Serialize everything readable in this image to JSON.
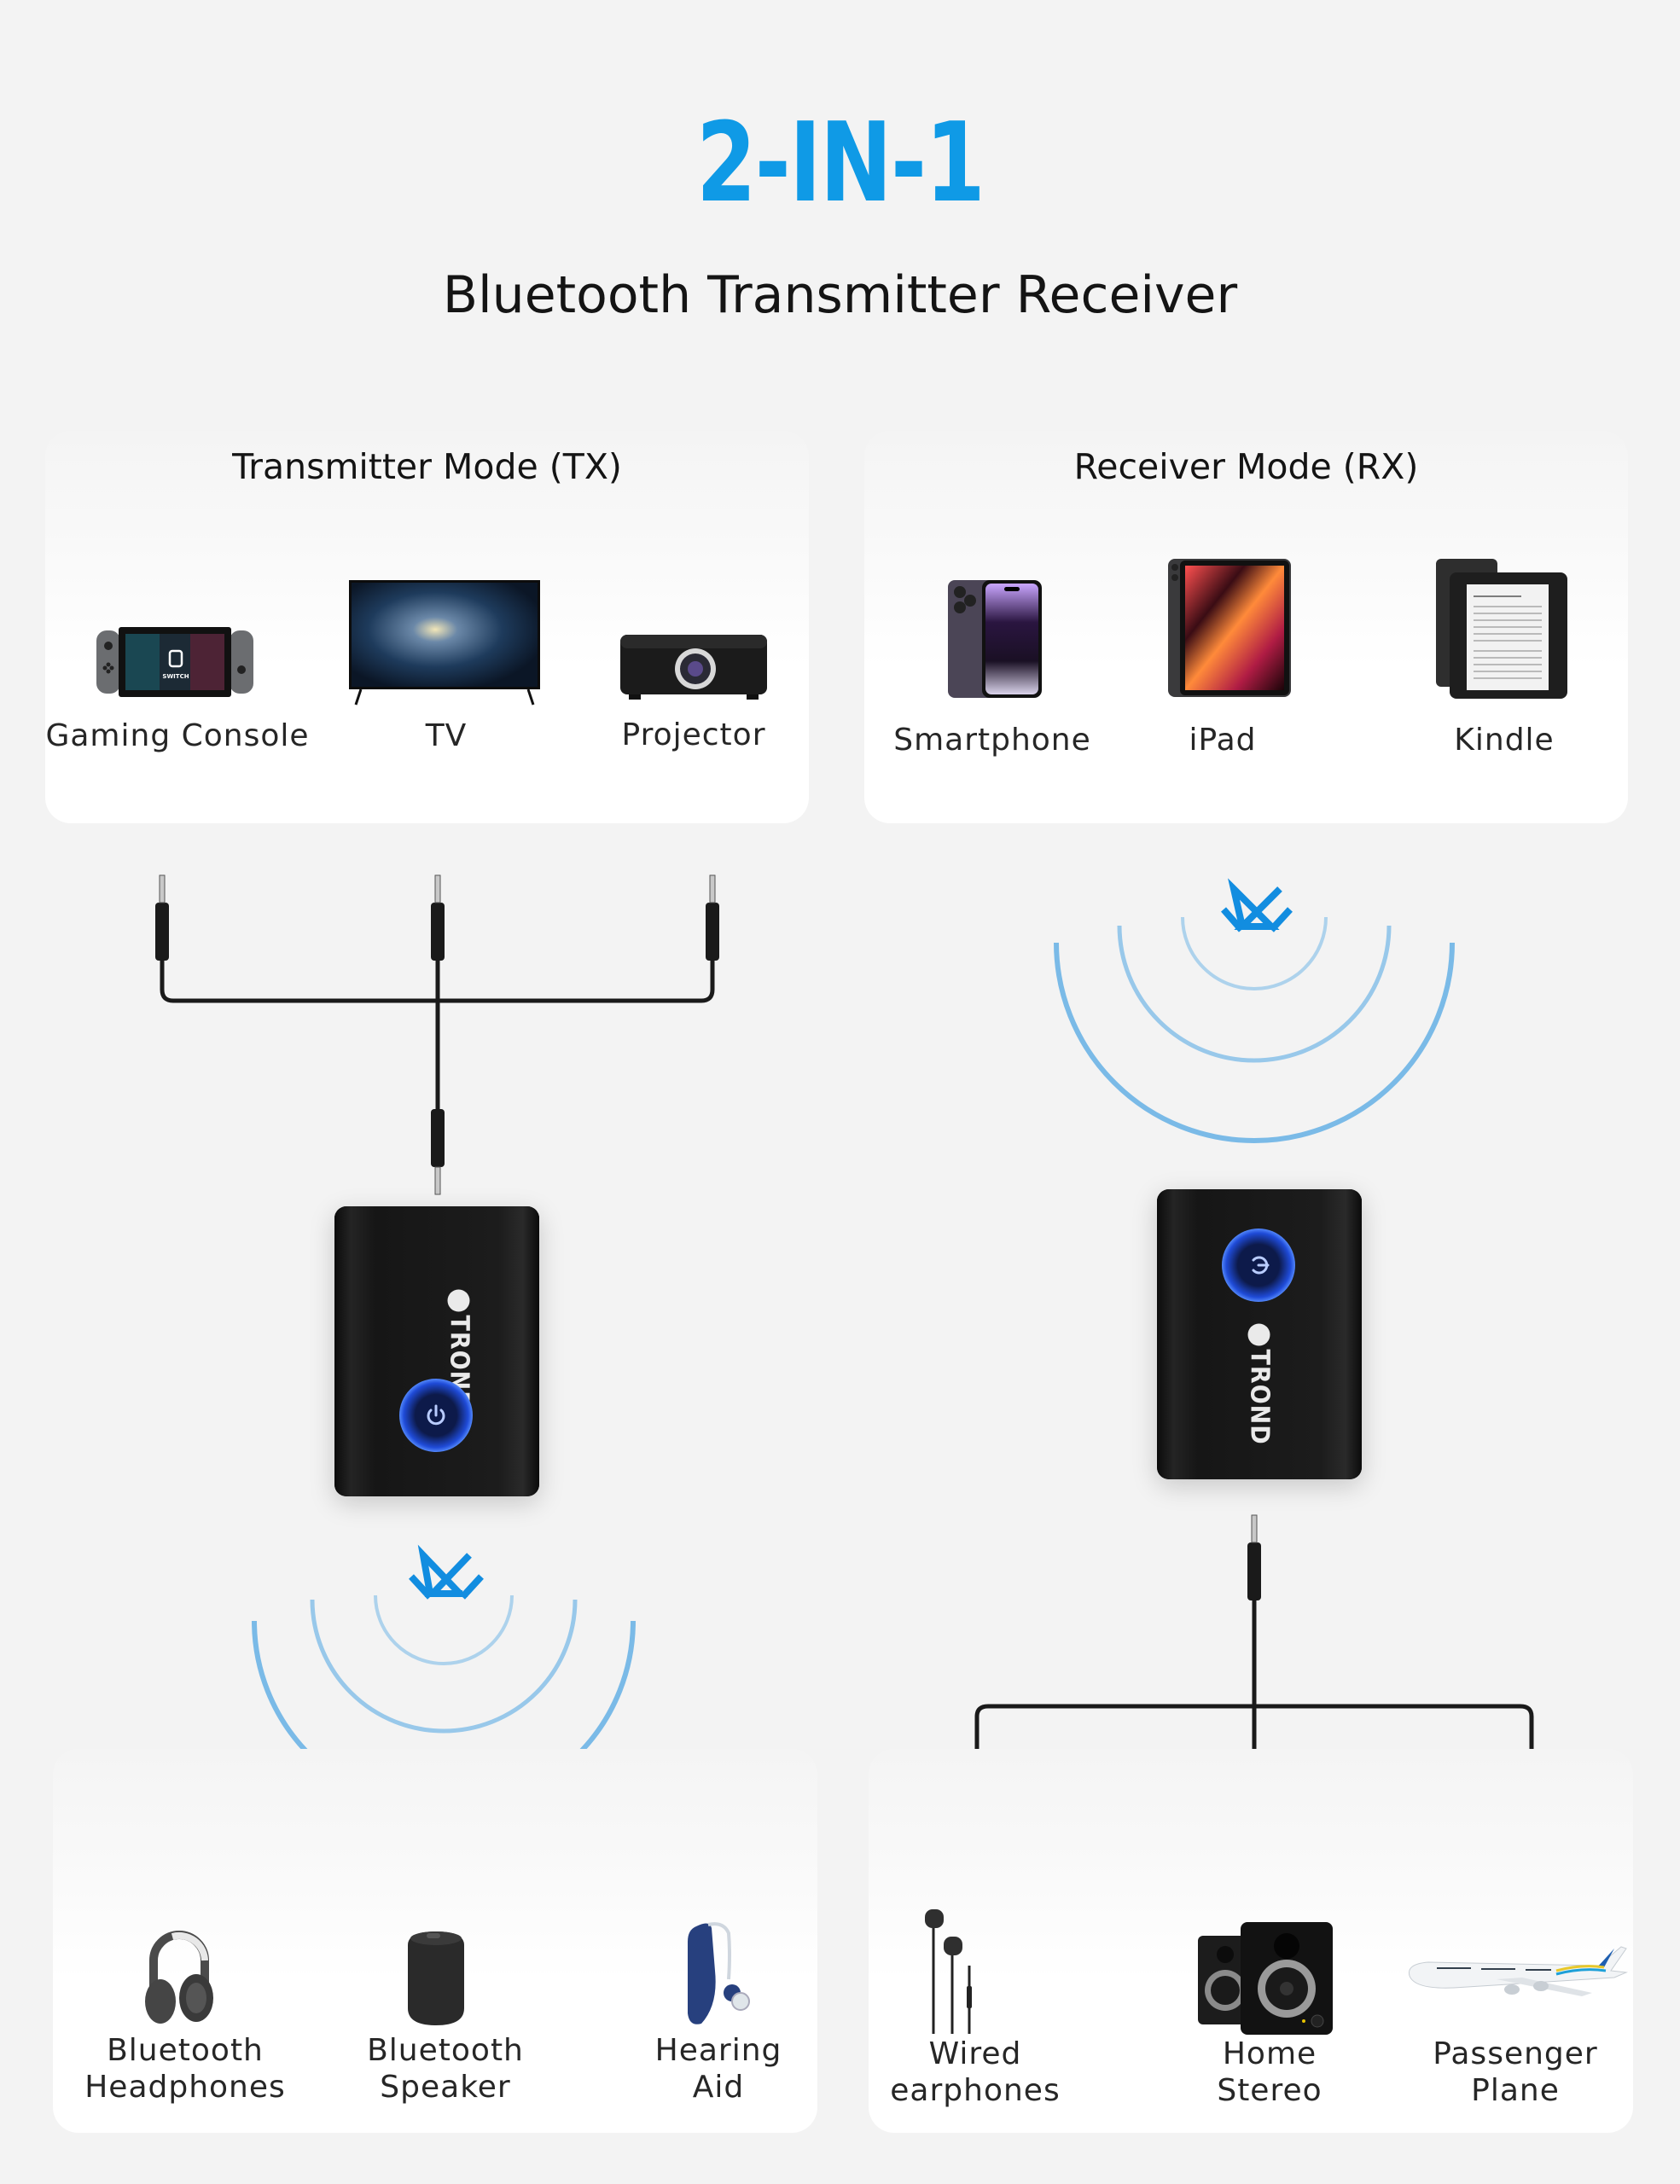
{
  "header": {
    "headline": "2-IN-1",
    "subtitle": "Bluetooth Transmitter Receiver"
  },
  "colors": {
    "accent": "#0f9ae6",
    "background": "#f3f3f3",
    "card": "#ffffff",
    "device_body": "#141414",
    "power_glow": "#2e6cff"
  },
  "transmitter": {
    "title": "Transmitter Mode (TX)",
    "sources": [
      {
        "label": "Gaming Console",
        "icon": "game-console-icon"
      },
      {
        "label": "TV",
        "icon": "tv-icon"
      },
      {
        "label": "Projector",
        "icon": "projector-icon"
      }
    ],
    "device_brand": "TROND",
    "outputs": [
      {
        "line1": "Bluetooth",
        "line2": "Headphones",
        "icon": "headphones-icon"
      },
      {
        "line1": "Bluetooth",
        "line2": "Speaker",
        "icon": "speaker-icon"
      },
      {
        "line1": "Hearing",
        "line2": "Aid",
        "icon": "hearing-aid-icon"
      }
    ]
  },
  "receiver": {
    "title": "Receiver Mode (RX)",
    "sources": [
      {
        "label": "Smartphone",
        "icon": "smartphone-icon"
      },
      {
        "label": "iPad",
        "icon": "tablet-icon"
      },
      {
        "label": "Kindle",
        "icon": "ereader-icon"
      }
    ],
    "device_brand": "TROND",
    "outputs": [
      {
        "line1": "Wired",
        "line2": "earphones",
        "icon": "earphones-icon"
      },
      {
        "line1": "Home",
        "line2": "Stereo",
        "icon": "stereo-speakers-icon"
      },
      {
        "line1": "Passenger",
        "line2": "Plane",
        "icon": "airplane-icon"
      }
    ]
  }
}
